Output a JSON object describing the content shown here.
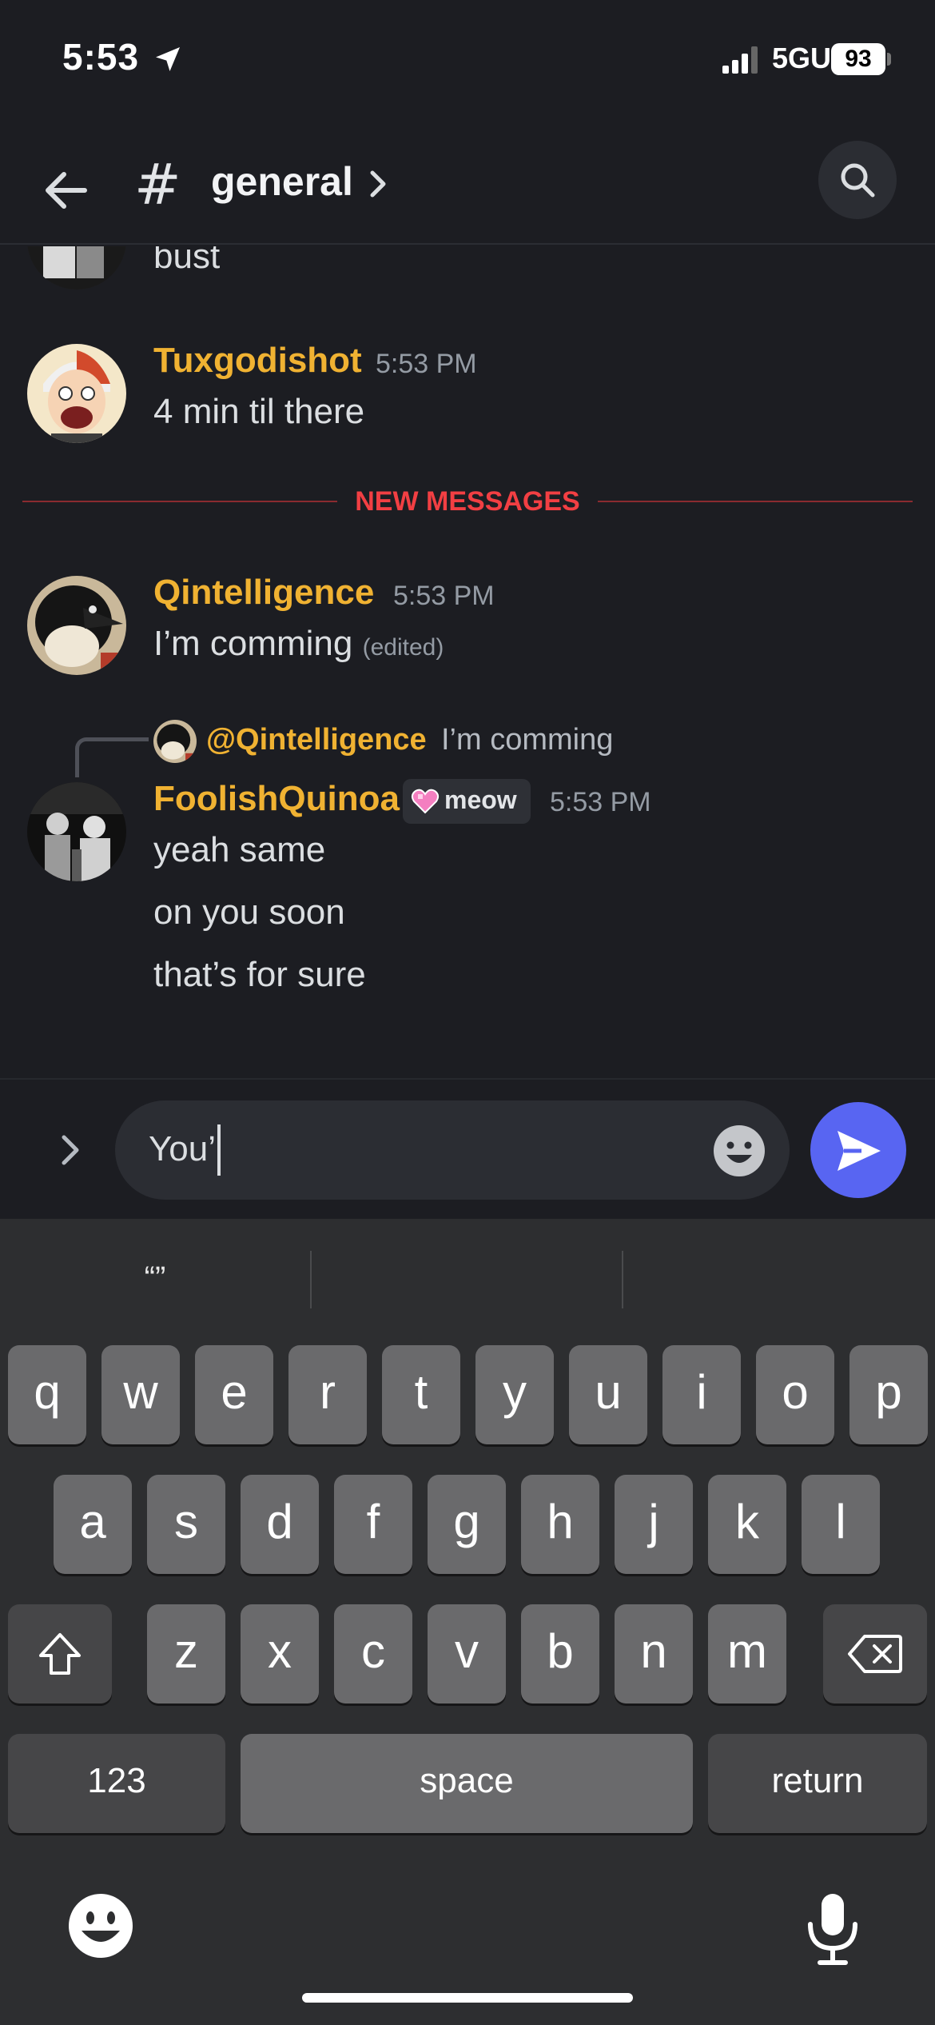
{
  "status_bar": {
    "time": "5:53",
    "network": "5GUC",
    "battery": "93"
  },
  "header": {
    "hash_symbol": "#",
    "channel_name": "general"
  },
  "messages": {
    "partial": {
      "text": "bust"
    },
    "tux": {
      "username": "Tuxgodishot",
      "timestamp": "5:53 PM",
      "text": "4 min til there"
    },
    "new_messages_label": "NEW MESSAGES",
    "qint": {
      "username": "Qintelligence",
      "timestamp": "5:53 PM",
      "text": "I’m comming",
      "edited": "(edited)"
    },
    "reply": {
      "username": "@Qintelligence",
      "text": "I’m comming"
    },
    "foolish": {
      "username": "FoolishQuinoa",
      "role_badge": "meow",
      "timestamp": "5:53 PM",
      "lines": [
        "yeah same",
        "on you soon",
        "that’s for sure"
      ]
    }
  },
  "composer": {
    "value": "You’"
  },
  "keyboard": {
    "suggestions": [
      "“”",
      "",
      ""
    ],
    "row1": [
      "q",
      "w",
      "e",
      "r",
      "t",
      "y",
      "u",
      "i",
      "o",
      "p"
    ],
    "row2": [
      "a",
      "s",
      "d",
      "f",
      "g",
      "h",
      "j",
      "k",
      "l"
    ],
    "row3": [
      "z",
      "x",
      "c",
      "v",
      "b",
      "n",
      "m"
    ],
    "numbers_label": "123",
    "space_label": "space",
    "return_label": "return"
  },
  "colors": {
    "background": "#1c1d22",
    "username": "#f0b232",
    "new_messages": "#f23f43",
    "send_button": "#5865f2",
    "keyboard": "#2d2e30"
  }
}
